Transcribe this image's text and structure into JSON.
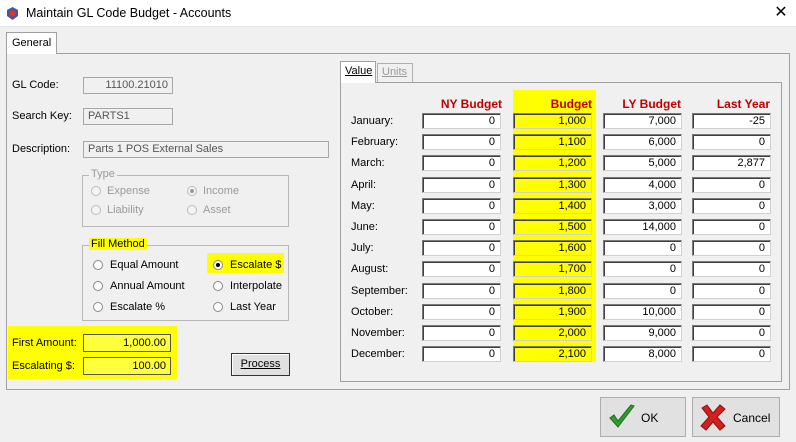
{
  "window": {
    "title": "Maintain GL Code Budget - Accounts",
    "close_glyph": "✕"
  },
  "tabs": {
    "general": "General"
  },
  "form": {
    "gl_code_label": "GL Code:",
    "gl_code": "11100.21010",
    "search_key_label": "Search Key:",
    "search_key": "PARTS1",
    "description_label": "Description:",
    "description": "Parts 1 POS External Sales"
  },
  "type_group": {
    "legend": "Type",
    "options": [
      "Expense",
      "Income",
      "Liability",
      "Asset"
    ],
    "selected": "Income"
  },
  "fill_method": {
    "legend": "Fill Method",
    "options": [
      "Equal Amount",
      "Escalate $",
      "Annual Amount",
      "Interpolate",
      "Escalate %",
      "Last Year"
    ],
    "selected": "Escalate $"
  },
  "amounts": {
    "first_amount_label": "First Amount:",
    "first_amount": "1,000.00",
    "escalating_label": "Escalating $:",
    "escalating": "100.00"
  },
  "process_button": "Process",
  "subtabs": {
    "value": "Value",
    "units": "Units"
  },
  "grid": {
    "headers": [
      "NY Budget",
      "Budget",
      "LY Budget",
      "Last Year"
    ],
    "rows": [
      {
        "month": "January:",
        "ny": "0",
        "budget": "1,000",
        "ly": "7,000",
        "last": "-25"
      },
      {
        "month": "February:",
        "ny": "0",
        "budget": "1,100",
        "ly": "6,000",
        "last": "0"
      },
      {
        "month": "March:",
        "ny": "0",
        "budget": "1,200",
        "ly": "5,000",
        "last": "2,877"
      },
      {
        "month": "April:",
        "ny": "0",
        "budget": "1,300",
        "ly": "4,000",
        "last": "0"
      },
      {
        "month": "May:",
        "ny": "0",
        "budget": "1,400",
        "ly": "3,000",
        "last": "0"
      },
      {
        "month": "June:",
        "ny": "0",
        "budget": "1,500",
        "ly": "14,000",
        "last": "0"
      },
      {
        "month": "July:",
        "ny": "0",
        "budget": "1,600",
        "ly": "0",
        "last": "0"
      },
      {
        "month": "August:",
        "ny": "0",
        "budget": "1,700",
        "ly": "0",
        "last": "0"
      },
      {
        "month": "September:",
        "ny": "0",
        "budget": "1,800",
        "ly": "0",
        "last": "0"
      },
      {
        "month": "October:",
        "ny": "0",
        "budget": "1,900",
        "ly": "10,000",
        "last": "0"
      },
      {
        "month": "November:",
        "ny": "0",
        "budget": "2,000",
        "ly": "9,000",
        "last": "0"
      },
      {
        "month": "December:",
        "ny": "0",
        "budget": "2,100",
        "ly": "8,000",
        "last": "0"
      }
    ]
  },
  "buttons": {
    "ok": "OK",
    "cancel": "Cancel"
  },
  "colors": {
    "highlight": "#ffff00",
    "header_red": "#c00000",
    "ok_green": "#2e9e2e",
    "cancel_red": "#d02020"
  }
}
